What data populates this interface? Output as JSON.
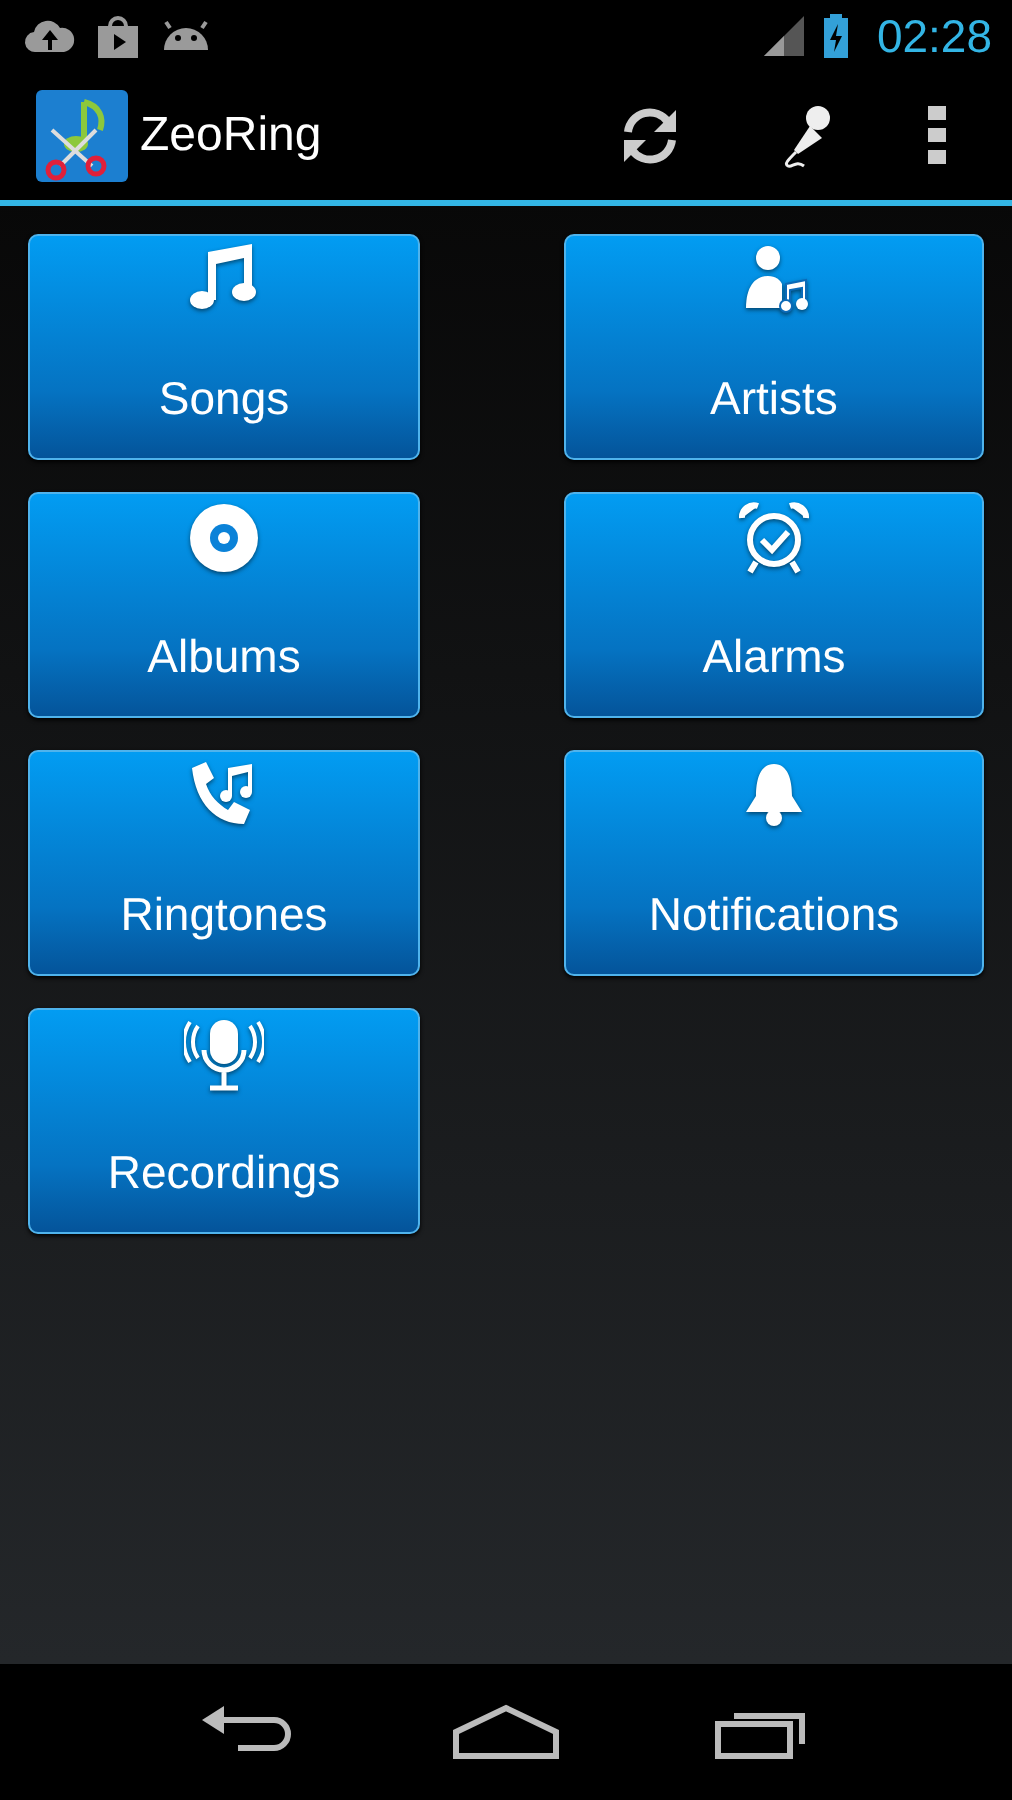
{
  "status_bar": {
    "time": "02:28"
  },
  "action_bar": {
    "title": "ZeoRing"
  },
  "tiles": [
    {
      "label": "Songs",
      "kind": "songs"
    },
    {
      "label": "Artists",
      "kind": "artists"
    },
    {
      "label": "Albums",
      "kind": "albums"
    },
    {
      "label": "Alarms",
      "kind": "alarms"
    },
    {
      "label": "Ringtones",
      "kind": "ringtones"
    },
    {
      "label": "Notifications",
      "kind": "notifications"
    },
    {
      "label": "Recordings",
      "kind": "recordings"
    }
  ]
}
